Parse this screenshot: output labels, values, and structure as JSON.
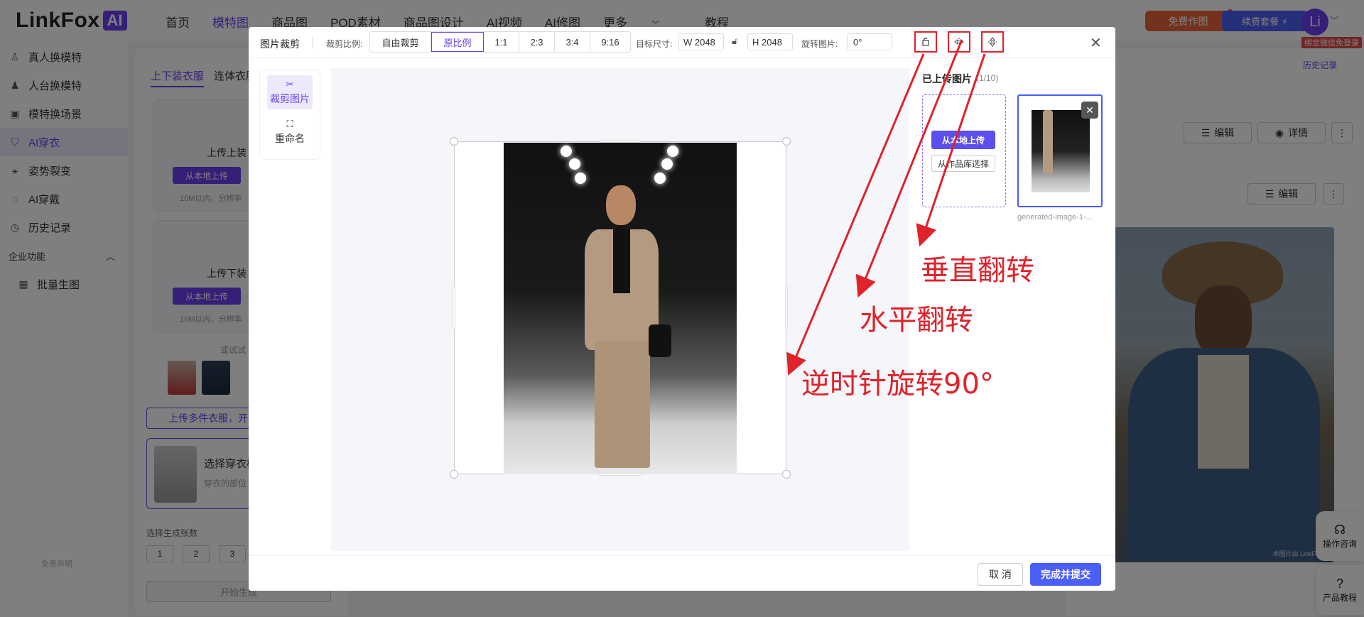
{
  "app": {
    "logo_text": "LinkFox",
    "logo_badge": "AI"
  },
  "nav": {
    "items": [
      "首页",
      "模特图",
      "商品图",
      "POD素材",
      "商品图设计",
      "AI视频",
      "AI修图",
      "更多",
      "教程"
    ],
    "active_index": 1,
    "more_caret": "﹀",
    "free_button": "免费作图",
    "renew_button": "续费套餐 ⚡",
    "avatar_initial": "Li",
    "avatar_caret": "﹀",
    "bind_tag": "绑定微信免登录"
  },
  "sidebar": {
    "items": [
      {
        "label": "真人换模特",
        "icon": "person-swap-icon"
      },
      {
        "label": "人台换模特",
        "icon": "mannequin-icon"
      },
      {
        "label": "模特换场景",
        "icon": "scene-icon"
      },
      {
        "label": "AI穿衣",
        "icon": "shirt-icon"
      },
      {
        "label": "姿势裂变",
        "icon": "pose-icon"
      },
      {
        "label": "AI穿戴",
        "icon": "ring-icon"
      },
      {
        "label": "历史记录",
        "icon": "clock-icon"
      }
    ],
    "active_index": 3,
    "section_title": "企业功能",
    "section_items": [
      {
        "label": "批量生图",
        "icon": "image-icon"
      }
    ],
    "footer": "免责声明"
  },
  "workspace": {
    "tabs": [
      "上下装衣服",
      "连体衣服"
    ],
    "upload_top_caption": "上传上装",
    "upload_bottom_caption": "上传下装",
    "upload_button": "从本地上传",
    "upload_hint": "10M以内，分辨率",
    "try_label": "或试试",
    "multi_upload": "上传多件衣服，开",
    "model_caption": "选择穿衣模",
    "model_sub": "穿衣的部位",
    "count_label": "选择生成张数",
    "counts": [
      "1",
      "2",
      "3"
    ],
    "generate_button": "开始生成",
    "history_link": "历史记录",
    "edit_label": "编辑",
    "detail_label": "详情",
    "more_label": "⋮",
    "help_consult": "操作咨询",
    "help_tutorial": "产品教程",
    "watermark": "本图片由 LinkFoxAI"
  },
  "modal": {
    "title": "图片裁剪",
    "ratio_label": "裁剪比例:",
    "ratios": [
      "自由裁剪",
      "原比例",
      "1:1",
      "2:3",
      "3:4",
      "9:16"
    ],
    "active_ratio_index": 1,
    "target_label": "目标尺寸:",
    "width_value": "W 2048",
    "height_value": "H 2048",
    "rotate_label": "旋转图片:",
    "rotate_value": "0°",
    "tools": [
      {
        "label": "裁剪图片",
        "icon": "scissors-icon",
        "active": true
      },
      {
        "label": "重命名",
        "icon": "rename-icon",
        "active": false
      }
    ],
    "uploaded_title": "已上传图片",
    "uploaded_count": "(1/10)",
    "local_upload": "从本地上传",
    "library_select": "从作品库选择",
    "file_name": "generated-image-1-...",
    "cancel": "取 消",
    "submit": "完成并提交"
  },
  "annotations": {
    "color": "#e0222a",
    "vertical_flip": "垂直翻转",
    "horizontal_flip": "水平翻转",
    "rotate_ccw": "逆时针旋转90°"
  },
  "colors": {
    "brand": "#6b3ff0",
    "primary_blue": "#4b5ef5",
    "free_orange": "#e8643b",
    "annotation_red": "#e0222a"
  }
}
